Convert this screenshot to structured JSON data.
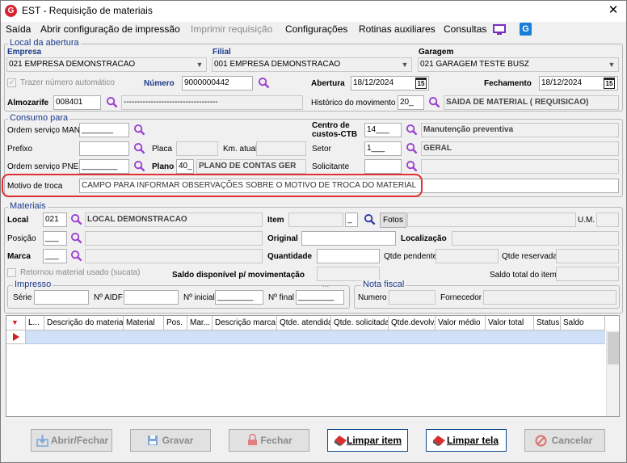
{
  "window": {
    "title": "EST - Requisição de materiais",
    "close": "✕",
    "logo": "G"
  },
  "menu": [
    "Saída",
    "Abrir configuração de impressão",
    "Imprimir requisição",
    "Configurações",
    "Rotinas auxiliares",
    "Consultas"
  ],
  "local_abertura": {
    "legend": "Local da abertura",
    "empresa_label": "Empresa",
    "empresa": "021 EMPRESA DEMONSTRACAO",
    "filial_label": "Filial",
    "filial": "001 EMPRESA DEMONSTRACAO",
    "garagem_label": "Garagem",
    "garagem": "021 GARAGEM TESTE BUSZ",
    "trazer": "Trazer número automático",
    "numero_label": "Número",
    "numero": "9000000442",
    "abertura_label": "Abertura",
    "abertura": "18/12/2024",
    "fechamento_label": "Fechamento",
    "fechamento": "18/12/2024",
    "cal": "15",
    "almox_label": "Almozarife",
    "almox_code": "008401",
    "almox_name": "-----------------------------------",
    "historico_label": "Histórico do movimento",
    "historico_code": "20_",
    "historico_name": "SAIDA DE MATERIAL ( REQUISICAO)"
  },
  "consumo": {
    "legend": "Consumo para",
    "os_man": "Ordem serviço MAN",
    "os_man_val": "_______",
    "prefixo": "Prefixo",
    "placa": "Placa",
    "km": "Km. atual",
    "os_pne": "Ordem serviço PNE",
    "os_pne_val": "________",
    "plano": "Plano",
    "plano_code": "40_",
    "plano_name": "PLANO DE CONTAS GER",
    "cc_label1": "Centro de",
    "cc_label2": "custos-CTB",
    "cc_code": "14___",
    "cc_name": "Manutenção preventiva",
    "setor": "Setor",
    "setor_code": "1___",
    "setor_name": "GERAL",
    "solicitante": "Solicitante",
    "motivo": "Motivo de troca",
    "motivo_val": "CAMPO PARA INFORMAR OBSERVAÇÕES SOBRE O MOTIVO DE TROCA DO MATERIAL"
  },
  "materiais": {
    "legend": "Materiais",
    "local": "Local",
    "local_code": "021",
    "local_name": "LOCAL DEMONSTRACAO",
    "item": "Item",
    "item_suffix": "_",
    "fotos": "Fotos",
    "um": "U.M.",
    "posicao": "Posição",
    "posicao_val": "___",
    "original": "Original",
    "localizacao": "Localização",
    "marca": "Marca",
    "marca_val": "___",
    "quantidade": "Quantidade",
    "qtde_pendente": "Qtde pendente",
    "qtde_reservada": "Qtde reservada",
    "retornou": "Retornou material usado (sucata)",
    "saldo_disp": "Saldo disponível p/ movimentação",
    "saldo_total": "Saldo total do item"
  },
  "impresso": {
    "legend": "Impresso",
    "serie": "Série",
    "aidf": "Nº AIDF",
    "ninicial": "Nº inicial",
    "ninicial_val": "________",
    "nfinal": "Nº final",
    "nfinal_val": "________",
    "dots": "..."
  },
  "nota_fiscal": {
    "legend": "Nota fiscal",
    "numero": "Numero",
    "fornecedor": "Fornecedor"
  },
  "grid": {
    "sort": "▼",
    "columns": [
      "L...",
      "Descrição do material",
      "Material",
      "Pos.",
      "Mar...",
      "Descrição marca",
      "Qtde. atendida",
      "Qtde. solicitada",
      "Qtde.devolv.",
      "Valor médio",
      "Valor total",
      "Status",
      "Saldo"
    ]
  },
  "buttons": {
    "abrir": "Abrir/Fechar",
    "gravar": "Gravar",
    "fechar": "Fechar",
    "limpar_item": "Limpar item",
    "limpar_tela": "Limpar tela",
    "cancelar": "Cancelar"
  },
  "colors": {
    "accent": "#1a3a8c",
    "highlight": "#e03030",
    "magnifier": "#9b3fd0",
    "grid_row": "#cfe0f7"
  }
}
